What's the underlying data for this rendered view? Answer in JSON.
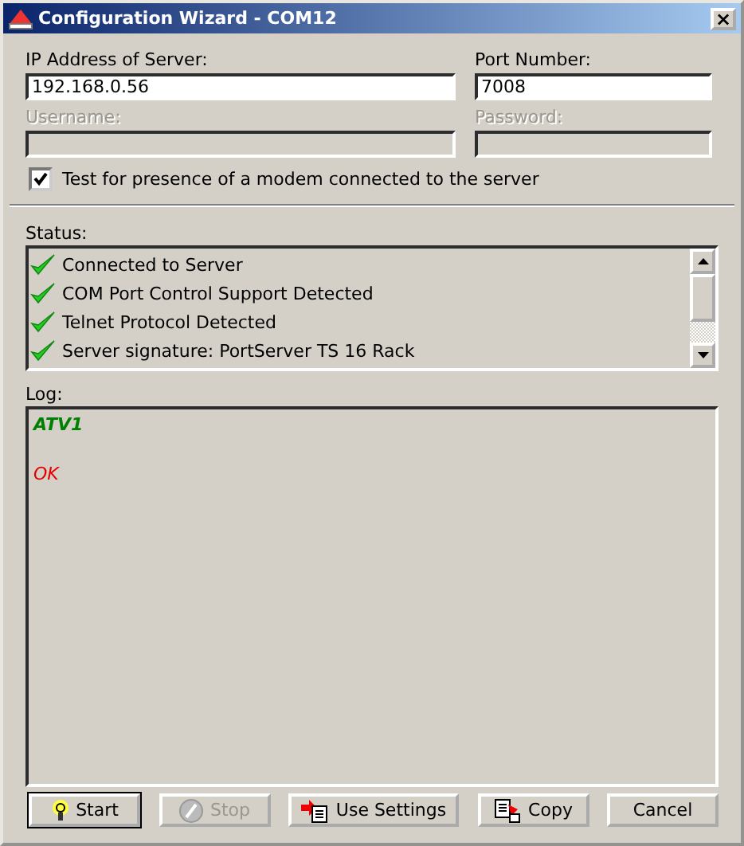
{
  "window": {
    "title": "Configuration Wizard - COM12",
    "close": "×"
  },
  "server": {
    "label": "IP Address of Server:",
    "value": "192.168.0.56",
    "disabled": false
  },
  "port": {
    "label": "Port Number:",
    "value": "7008",
    "disabled": false
  },
  "username": {
    "label": "Username:",
    "disabled": true
  },
  "password": {
    "label": "Password:",
    "disabled": true
  },
  "modem_test": {
    "label": "Test for presence of a modem connected to the server",
    "checked": true
  },
  "status": {
    "label": "Status:",
    "items": [
      {
        "text": "Connected to Server",
        "kind": "ok"
      },
      {
        "text": "COM Port Control Support Detected",
        "kind": "ok"
      },
      {
        "text": "Telnet Protocol Detected",
        "kind": "ok"
      },
      {
        "text": "Server signature: PortServer TS 16 Rack",
        "kind": "ok"
      }
    ]
  },
  "log": {
    "label": "Log:",
    "lines": [
      {
        "text": "ATV1",
        "kind": "command"
      },
      {
        "text": "OK",
        "kind": "response"
      }
    ]
  },
  "buttons": [
    {
      "label": "Start",
      "kind": "bulb",
      "disabled": false,
      "default": true
    },
    {
      "label": "Stop",
      "kind": "stop",
      "disabled": true,
      "default": false
    },
    {
      "label": "Use Settings",
      "kind": "apply",
      "disabled": false,
      "default": false
    },
    {
      "label": "Copy",
      "kind": "copy",
      "disabled": false,
      "default": false
    },
    {
      "label": "Cancel",
      "kind": "plain",
      "disabled": false,
      "default": false
    }
  ]
}
